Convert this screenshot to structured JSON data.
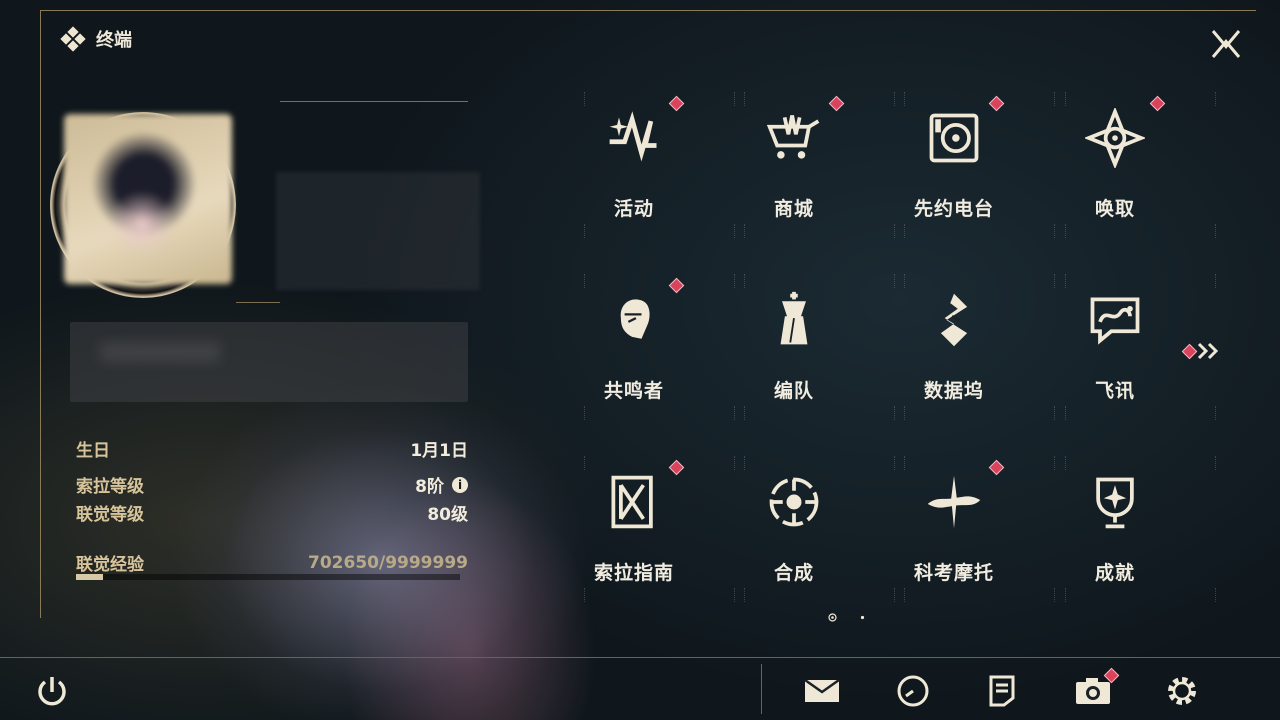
{
  "header": {
    "title": "终端"
  },
  "profile": {
    "info": [
      {
        "key": "生日",
        "value": "1月1日"
      },
      {
        "key": "索拉等级",
        "value": "8阶"
      },
      {
        "key": "联觉等级",
        "value": "80级"
      }
    ],
    "info_icon": "i",
    "exp": {
      "label": "联觉经验",
      "value": "702650/9999999",
      "fraction": 0.0703
    }
  },
  "grid": [
    {
      "label": "活动",
      "icon": "event-icon",
      "badge": true
    },
    {
      "label": "商城",
      "icon": "shop-icon",
      "badge": true
    },
    {
      "label": "先约电台",
      "icon": "radio-icon",
      "badge": true
    },
    {
      "label": "唤取",
      "icon": "convene-icon",
      "badge": true
    },
    {
      "label": "共鸣者",
      "icon": "resonator-icon",
      "badge": true
    },
    {
      "label": "编队",
      "icon": "team-icon",
      "badge": false
    },
    {
      "label": "数据坞",
      "icon": "data-bank-icon",
      "badge": false
    },
    {
      "label": "飞讯",
      "icon": "message-icon",
      "badge": false
    },
    {
      "label": "索拉指南",
      "icon": "guidebook-icon",
      "badge": true
    },
    {
      "label": "合成",
      "icon": "synthesis-icon",
      "badge": false
    },
    {
      "label": "科考摩托",
      "icon": "motorcycle-icon",
      "badge": true
    },
    {
      "label": "成就",
      "icon": "achievement-icon",
      "badge": false
    }
  ],
  "pagination": {
    "current": 1,
    "total": 2
  },
  "bottom_bar": [
    "mail-icon",
    "clock-icon",
    "notes-icon",
    "camera-icon",
    "settings-icon"
  ],
  "colors": {
    "accent": "#d8c9a6",
    "badge": "#d9445c",
    "background": "#0f171c"
  }
}
